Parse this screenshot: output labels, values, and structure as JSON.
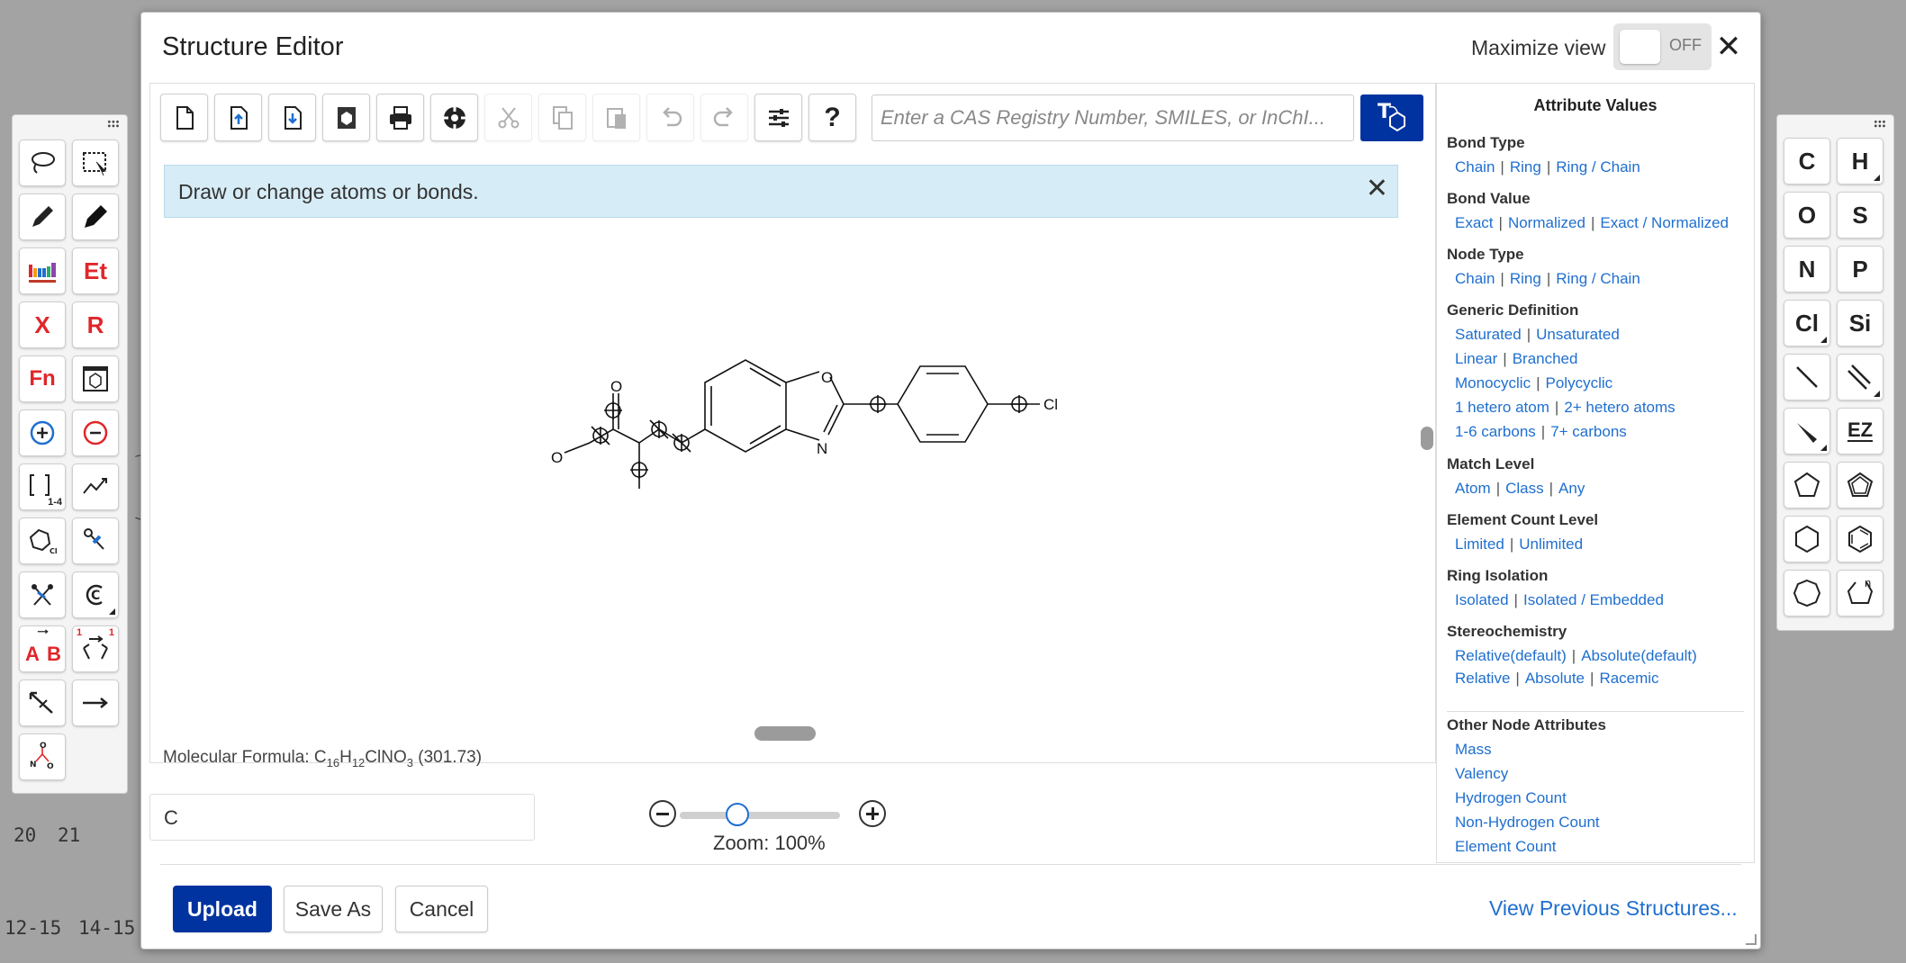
{
  "background": {
    "numbers": [
      "20",
      "21",
      "12-15",
      "14-15"
    ]
  },
  "dialog": {
    "title": "Structure Editor",
    "maximize_label": "Maximize view",
    "toggle_state": "OFF",
    "close_glyph": "✕"
  },
  "toolbar": {
    "tools": [
      "new-document-icon",
      "import-icon",
      "export-icon",
      "template-icon",
      "print-icon",
      "clean-structure-icon",
      "cut-icon",
      "copy-icon",
      "paste-icon",
      "undo-icon",
      "redo-icon",
      "settings-sliders-icon",
      "help-icon"
    ],
    "help_glyph": "?",
    "search_placeholder": "Enter a CAS Registry Number, SMILES, or InChI...",
    "text_to_structure_icon": "text-to-structure-icon"
  },
  "banner": {
    "message": "Draw or change atoms or bonds.",
    "close_glyph": "✕"
  },
  "molecule": {
    "atoms": {
      "O1": "O",
      "O2": "O",
      "O3": "O",
      "N": "N",
      "Cl": "Cl"
    }
  },
  "formula": {
    "label": "Molecular Formula: ",
    "parts": [
      {
        "t": "C",
        "sub": "16"
      },
      {
        "t": "H",
        "sub": "12"
      },
      {
        "t": "ClNO",
        "sub": "3"
      }
    ],
    "mass": " (301.73)"
  },
  "bottom": {
    "atom_input_value": "C",
    "zoom_label": "Zoom: 100%",
    "zoom_percent": 100
  },
  "buttons": {
    "upload": "Upload",
    "save_as": "Save As",
    "cancel": "Cancel",
    "view_previous": "View Previous Structures..."
  },
  "attributes": {
    "title": "Attribute Values",
    "sections": [
      {
        "heading": "Bond Type",
        "lines": [
          [
            "Chain",
            "Ring",
            "Ring / Chain"
          ]
        ]
      },
      {
        "heading": "Bond Value",
        "lines": [
          [
            "Exact",
            "Normalized",
            "Exact / Normalized"
          ]
        ]
      },
      {
        "heading": "Node Type",
        "lines": [
          [
            "Chain",
            "Ring",
            "Ring / Chain"
          ]
        ]
      },
      {
        "heading": "Generic Definition",
        "lines": [
          [
            "Saturated",
            "Unsaturated"
          ],
          [
            "Linear",
            "Branched"
          ],
          [
            "Monocyclic",
            "Polycyclic"
          ],
          [
            "1 hetero atom",
            "2+ hetero atoms"
          ],
          [
            "1-6 carbons",
            "7+ carbons"
          ]
        ]
      },
      {
        "heading": "Match Level",
        "lines": [
          [
            "Atom",
            "Class",
            "Any"
          ]
        ]
      },
      {
        "heading": "Element Count Level",
        "lines": [
          [
            "Limited",
            "Unlimited"
          ]
        ]
      },
      {
        "heading": "Ring Isolation",
        "lines": [
          [
            "Isolated",
            "Isolated / Embedded"
          ]
        ]
      },
      {
        "heading": "Stereochemistry",
        "lines": [
          [
            "Relative(default)",
            "Absolute(default)"
          ],
          [
            "Relative",
            "Absolute",
            "Racemic"
          ]
        ]
      },
      {
        "heading": "Other Node Attributes",
        "lines": [
          [
            "Mass"
          ],
          [
            "Valency"
          ],
          [
            "Hydrogen Count"
          ],
          [
            "Non-Hydrogen Count"
          ],
          [
            "Element Count"
          ]
        ]
      }
    ]
  },
  "left_palette": {
    "labels": {
      "ethyl": "Et",
      "halogen": "X",
      "rgroup": "R",
      "function": "Fn",
      "bracket": "1-4",
      "reaction_a": "A",
      "reaction_b": "B",
      "map_1": "1",
      "map_2": "1"
    }
  },
  "right_palette": {
    "elements": [
      "C",
      "H",
      "O",
      "S",
      "N",
      "P",
      "Cl",
      "Si"
    ],
    "ez_label": "EZ",
    "custom_ring_label": "n"
  }
}
